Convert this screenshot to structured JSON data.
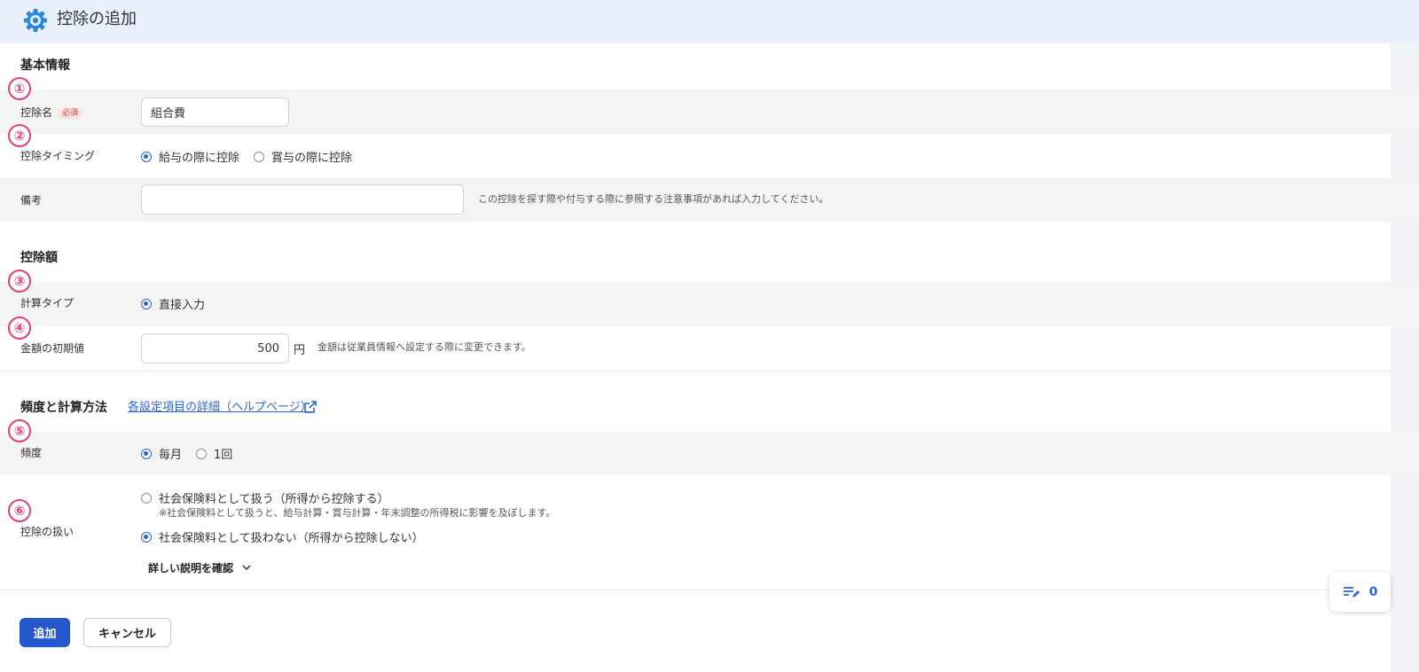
{
  "header": {
    "title": "控除の追加",
    "icon": "gear-icon"
  },
  "sections": {
    "basic": "基本情報",
    "amount": "控除額",
    "frequency": "頻度と計算方法"
  },
  "help_link": "各設定項目の詳細（ヘルプページ）",
  "badges": [
    "①",
    "②",
    "③",
    "④",
    "⑤",
    "⑥"
  ],
  "fields": {
    "deduction_name": {
      "label": "控除名",
      "required": "必須",
      "value": "組合費"
    },
    "timing": {
      "label": "控除タイミング",
      "options": [
        "給与の際に控除",
        "賞与の際に控除"
      ],
      "selected": 0
    },
    "remarks": {
      "label": "備考",
      "value": "",
      "hint": "この控除を探す際や付与する際に参照する注意事項があれば入力してください。"
    },
    "calc_type": {
      "label": "計算タイプ",
      "options": [
        "直接入力"
      ],
      "selected": 0
    },
    "initial_amount": {
      "label": "金額の初期値",
      "value": "500",
      "unit": "円",
      "hint": "金額は従業員情報へ設定する際に変更できます。"
    },
    "freq": {
      "label": "頻度",
      "options": [
        "毎月",
        "1回"
      ],
      "selected": 0
    },
    "treatment": {
      "label": "控除の扱い",
      "options": [
        "社会保険料として扱う（所得から控除する）",
        "社会保険料として扱わない（所得から控除しない）"
      ],
      "note": "※社会保険料として扱うと、給与計算・賞与計算・年末調整の所得税に影響を及ぼします。",
      "selected": 1
    }
  },
  "expand_label": "詳しい説明を確認",
  "buttons": {
    "add": "追加",
    "cancel": "キャンセル"
  },
  "widget": {
    "count": "0"
  },
  "colors": {
    "accent": "#2456cc",
    "header_bg": "#e8f0fb",
    "badge": "#e0407a"
  }
}
